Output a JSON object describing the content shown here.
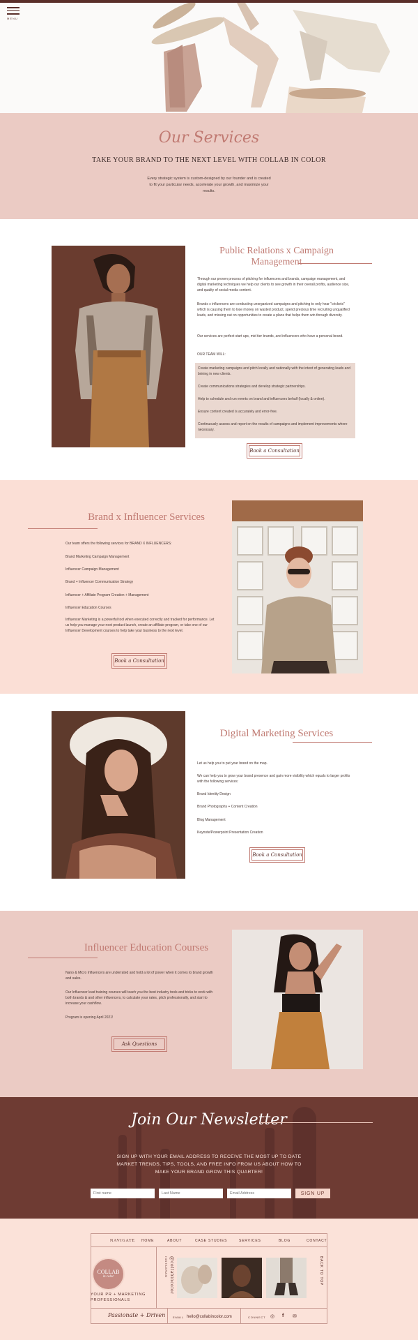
{
  "header": {
    "menu_label": "MENU"
  },
  "services_intro": {
    "script_title": "Our Services",
    "title": "TAKE YOUR BRAND TO THE NEXT LEVEL WITH COLLAB IN COLOR",
    "description": "Every strategic system is custom-designed by our founder and is created to fit your particular needs, accelerate your growth, and maximize your results."
  },
  "pr_section": {
    "heading": "Public Relations x Campaign Management",
    "p1": "Through our proven process of pitching for influencers and brands, campaign management, and digital marketing techniques we help our clients to see growth in their overall profits, audience size, and quality of social media content.",
    "p2": "Brands x influencers are conducting unorganized campaigns and pitching to only hear \"crickets\" which is causing them to lose money on wasted product, spend precious time recruiting unqualified leads, and missing out on opportunities to create a plans that helps them win through diversity.",
    "p3": "Our services are perfect start ups, mid tier brands, and influencers who have a personal brand.",
    "team_label": "OUR TEAM WILL:",
    "team_items": [
      "Create marketing campaigns and pitch locally and nationally with the intent of generating leads and brining in new clients.",
      "Create communications strategies and develop strategic partnerships.",
      "Help to schedule and run events on brand and influencers behalf (locally & online).",
      "Ensure content created is accurately and error-free.",
      "Continuously assess and report on the results of campaigns and implement improvements where necessary."
    ],
    "button": "Book a Consultation"
  },
  "brand_section": {
    "heading": "Brand x Influencer Services",
    "intro": "Our team offers the following services for BRAND X INFLUENCERS:",
    "items": [
      "Brand Marketing Campaign Management",
      "Influencer Campaign Management",
      "Brand + Influencer Communication Strategy",
      "Influencer + Affiliate Program Creation + Management",
      "Influencer Education Courses"
    ],
    "body": "Influencer Marketing is a powerful tool when executed correctly and tracked for performance. Let us help you manage your next product launch, create an affiliate program, or take one of our Influencer Development courses to help take your business to the next level.",
    "button": "Book a Consultation"
  },
  "digital_section": {
    "heading": "Digital Marketing Services",
    "p1": "Let us help you to put your brand on the map.",
    "p2": "We can help you to grow your brand presence and gain more visibility which equals to larger profits with the following services:",
    "items": [
      "Brand Identity Design",
      "Brand Photography + Content Creation",
      "Blog Management",
      "Keynote/Powerpoint Presentation Creation"
    ],
    "button": "Book a Consultation"
  },
  "education_section": {
    "heading": "Influencer Education Courses",
    "p1": "Nano & Micro Influencers are underrated and hold a lot of power when it comes to brand growth and sales.",
    "p2": "Our Influencer lead training courses will teach you the best industry tools and tricks to work with both brands & and other influencers, to calculate your rates, pitch professionally, and start to increase your cashflow.",
    "p3": "Program is opening April 2021!",
    "button": "Ask Questions"
  },
  "newsletter": {
    "title": "Join Our Newsletter",
    "description": "SIGN UP WITH YOUR EMAIL ADDRESS TO RECEIVE THE MOST UP TO DATE MARKET TRENDS, TIPS, TOOLS, AND FREE INFO FROM US ABOUT HOW TO MAKE YOUR BRAND GROW THIS QUARTER!",
    "first_name": "First name",
    "last_name": "Last Name",
    "email": "Email Address",
    "button": "SIGN UP"
  },
  "footer": {
    "nav_label": "NAVIGATE",
    "nav_items": [
      "HOME",
      "ABOUT",
      "CASE STUDIES",
      "SERVICES",
      "BLOG",
      "CONTACT"
    ],
    "logo_main": "COLLAB",
    "logo_sub": "in color",
    "tagline": "YOUR PR + MARKETING PROFESSIONALS",
    "instagram_label": "INSTAGRAM",
    "instagram_handle": "@collabincolor",
    "back_to_top": "BACK TO TOP",
    "signature": "Passionate + Driven",
    "email_label": "EMAIL",
    "email": "hello@collabincolor.com",
    "connect_label": "CONNECT"
  },
  "colors": {
    "accent": "#c07a72",
    "dark": "#5a2f2a",
    "blush": "#ebcbc4",
    "peach": "#fbdfd6"
  }
}
